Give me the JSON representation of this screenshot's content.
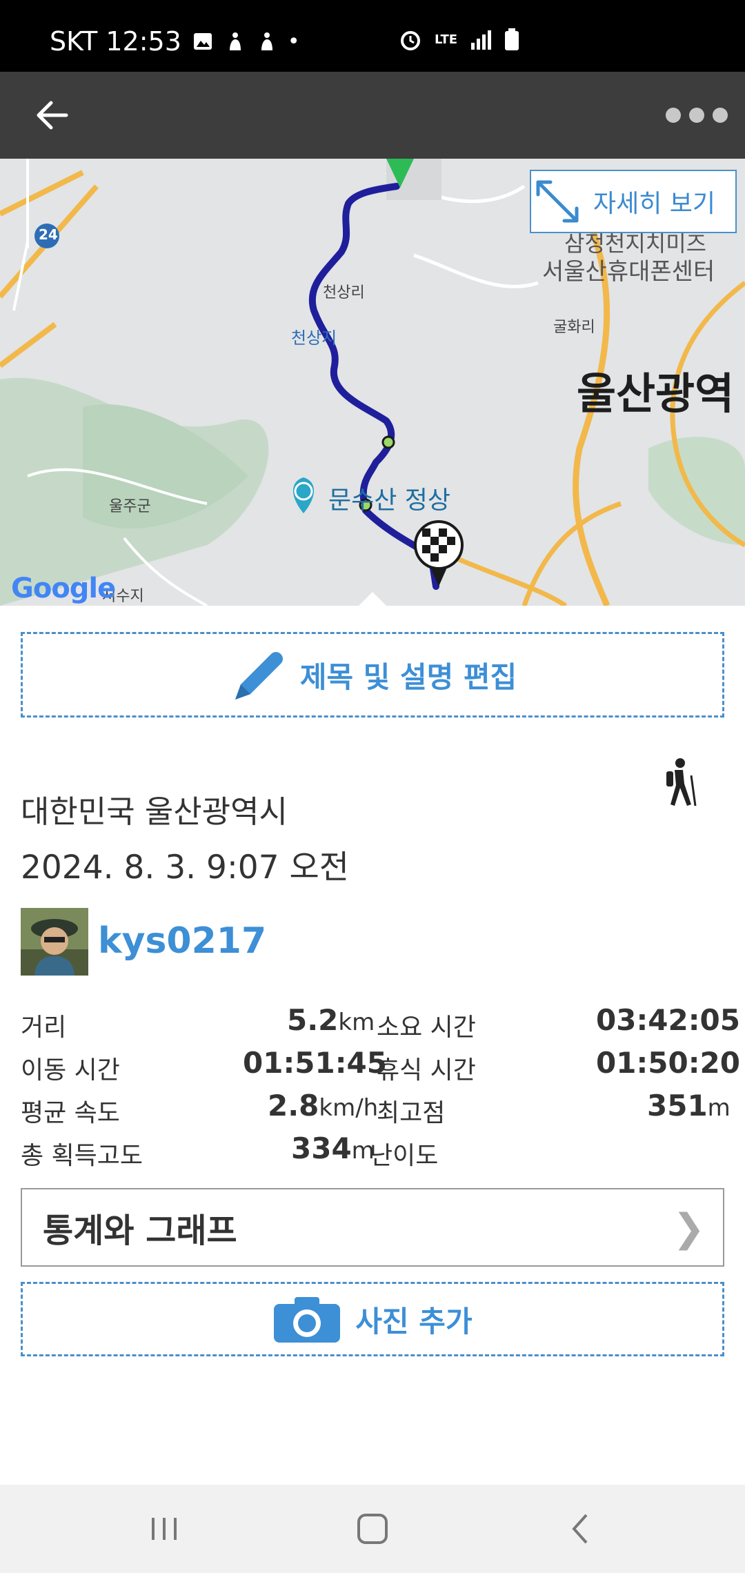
{
  "status_bar": {
    "carrier_time": "SKT 12:53",
    "network": "LTE",
    "dot": "•"
  },
  "app_bar": {
    "back_icon": "arrow-left-icon",
    "more_icon": "more-dots-icon"
  },
  "map": {
    "detail_button": "자세히 보기",
    "labels": {
      "cheonsangri": "천상리",
      "cheonsangji": "천상지",
      "ulju": "울주군",
      "gulhwari": "굴화리",
      "ulsan": "울산광역",
      "peak": "문수산 정상",
      "center_line1": "삼정천지치미즈",
      "center_line2": "서울산휴대폰센터",
      "reservoir": "저수지",
      "route_24": "24"
    },
    "google": "Google"
  },
  "edit_box": {
    "label": "제목 및 설명 편집"
  },
  "activity": {
    "location": "대한민국 울산광역시",
    "datetime": "2024. 8. 3. 9:07 오전",
    "username": "kys0217"
  },
  "stats": {
    "distance_label": "거리",
    "distance_value": "5.2",
    "distance_unit": "km",
    "total_time_label": "소요 시간",
    "total_time_value": "03:42:05",
    "moving_time_label": "이동 시간",
    "moving_time_value": "01:51:45",
    "rest_time_label": "휴식 시간",
    "rest_time_value": "01:50:20",
    "avg_speed_label": "평균 속도",
    "avg_speed_value": "2.8",
    "avg_speed_unit": "km/h",
    "max_elev_label": "최고점",
    "max_elev_value": "351",
    "max_elev_unit": "m",
    "gain_label": "총 획득고도",
    "gain_value": "334",
    "gain_unit": "m",
    "difficulty_label": "난이도"
  },
  "stats_button": {
    "label": "통계와 그래프",
    "chevron": "❯"
  },
  "photo_box": {
    "label": "사진 추가"
  },
  "colors": {
    "accent": "#3d8fd6",
    "route": "#1f1f9c",
    "app_bar": "#3d3d3d"
  }
}
